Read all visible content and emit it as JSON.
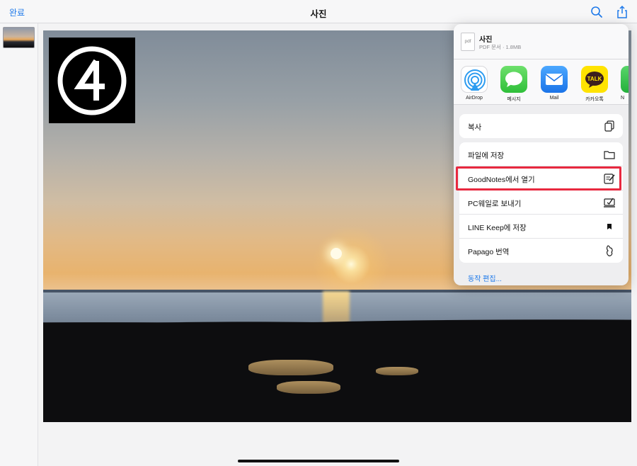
{
  "navbar": {
    "done_label": "완료",
    "title": "사진"
  },
  "share_sheet": {
    "file": {
      "icon_text": "pdf",
      "name": "사진",
      "meta": "PDF 문서 · 1.8MB"
    },
    "apps": [
      {
        "label": "AirDrop",
        "icon": "airdrop-icon"
      },
      {
        "label": "메시지",
        "icon": "messages-icon"
      },
      {
        "label": "Mail",
        "icon": "mail-icon"
      },
      {
        "label": "카카오톡",
        "icon": "kakaotalk-icon",
        "tile_text": "TALK"
      },
      {
        "label": "N",
        "icon": "app-icon"
      }
    ],
    "group1": [
      {
        "label": "복사",
        "icon": "copy-icon"
      }
    ],
    "group2": [
      {
        "label": "파일에 저장",
        "icon": "folder-icon"
      },
      {
        "label": "GoodNotes에서 열기",
        "icon": "goodnotes-icon"
      },
      {
        "label": "PC웨일로 보내기",
        "icon": "whale-icon"
      },
      {
        "label": "LINE Keep에 저장",
        "icon": "bookmark-icon"
      },
      {
        "label": "Papago 번역",
        "icon": "papago-icon"
      }
    ],
    "edit_actions_label": "동작 편집..."
  },
  "colors": {
    "accent": "#1f7aea",
    "highlight": "#e8283f"
  }
}
